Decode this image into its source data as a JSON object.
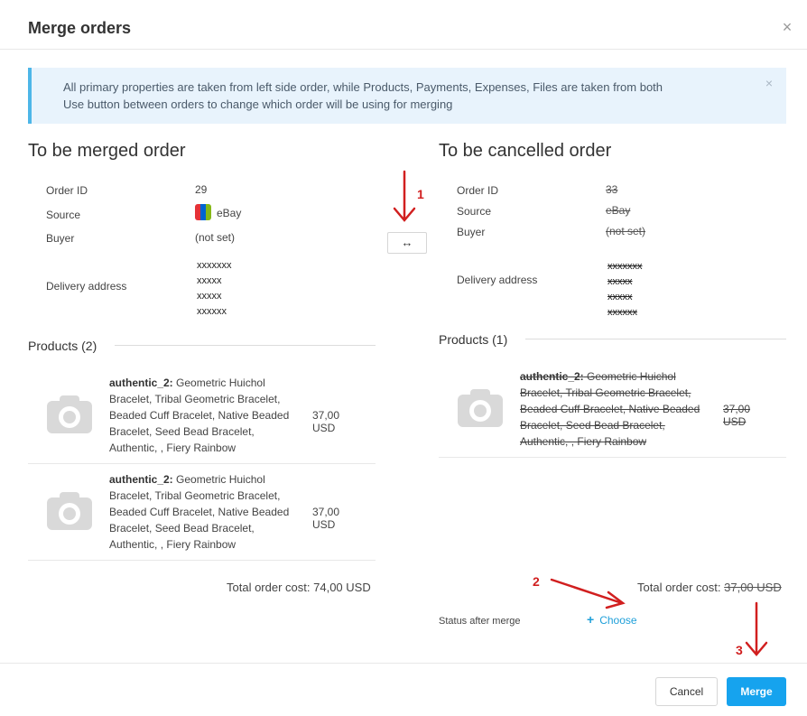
{
  "dialog": {
    "title": "Merge orders",
    "close_glyph": "×"
  },
  "info": {
    "line1": "All primary properties are taken from left side order, while Products, Payments, Expenses, Files are taken from both",
    "line2": "Use button between orders to change which order will be using for merging",
    "close_glyph": "×"
  },
  "left": {
    "title": "To be merged order",
    "order_id_label": "Order ID",
    "order_id": "29",
    "source_label": "Source",
    "source": "eBay",
    "buyer_label": "Buyer",
    "buyer": "(not set)",
    "delivery_label": "Delivery address",
    "address": [
      "xxxxxxx",
      "xxxxx",
      "xxxxx",
      "xxxxxx"
    ],
    "products_title": "Products (2)",
    "products": [
      {
        "name_bold": "authentic_2:",
        "name": "Geometric Huichol Bracelet, Tribal Geometric Bracelet, Beaded Cuff Bracelet, Native Beaded Bracelet, Seed Bead Bracelet, Authentic, , Fiery Rainbow",
        "price": "37,00 USD"
      },
      {
        "name_bold": "authentic_2:",
        "name": "Geometric Huichol Bracelet, Tribal Geometric Bracelet, Beaded Cuff Bracelet, Native Beaded Bracelet, Seed Bead Bracelet, Authentic, , Fiery Rainbow",
        "price": "37,00 USD"
      }
    ],
    "total_label": "Total order cost:",
    "total": "74,00 USD"
  },
  "swap": {
    "glyph": "↔"
  },
  "right": {
    "title": "To be cancelled order",
    "order_id_label": "Order ID",
    "order_id": "33",
    "source_label": "Source",
    "source": "eBay",
    "buyer_label": "Buyer",
    "buyer": "(not set)",
    "delivery_label": "Delivery address",
    "address": [
      "xxxxxxx",
      "xxxxx",
      "xxxxx",
      "xxxxxx"
    ],
    "products_title": "Products (1)",
    "products": [
      {
        "name_bold": "authentic_2:",
        "name": "Geometric Huichol Bracelet, Tribal Geometric Bracelet, Beaded Cuff Bracelet, Native Beaded Bracelet, Seed Bead Bracelet, Authentic, , Fiery Rainbow",
        "price": "37,00 USD"
      }
    ],
    "total_label": "Total order cost:",
    "total": "37,00 USD"
  },
  "status": {
    "label": "Status after merge",
    "choose_plus": "+",
    "choose": "Choose"
  },
  "footer": {
    "cancel": "Cancel",
    "merge": "Merge"
  },
  "annotations": {
    "a1": "1",
    "a2": "2",
    "a3": "3",
    "color": "#d11f1f"
  },
  "colors": {
    "primary": "#16a3ee",
    "link": "#1e9fd9",
    "info_bg": "#e8f3fc",
    "info_border": "#4db6e8"
  }
}
